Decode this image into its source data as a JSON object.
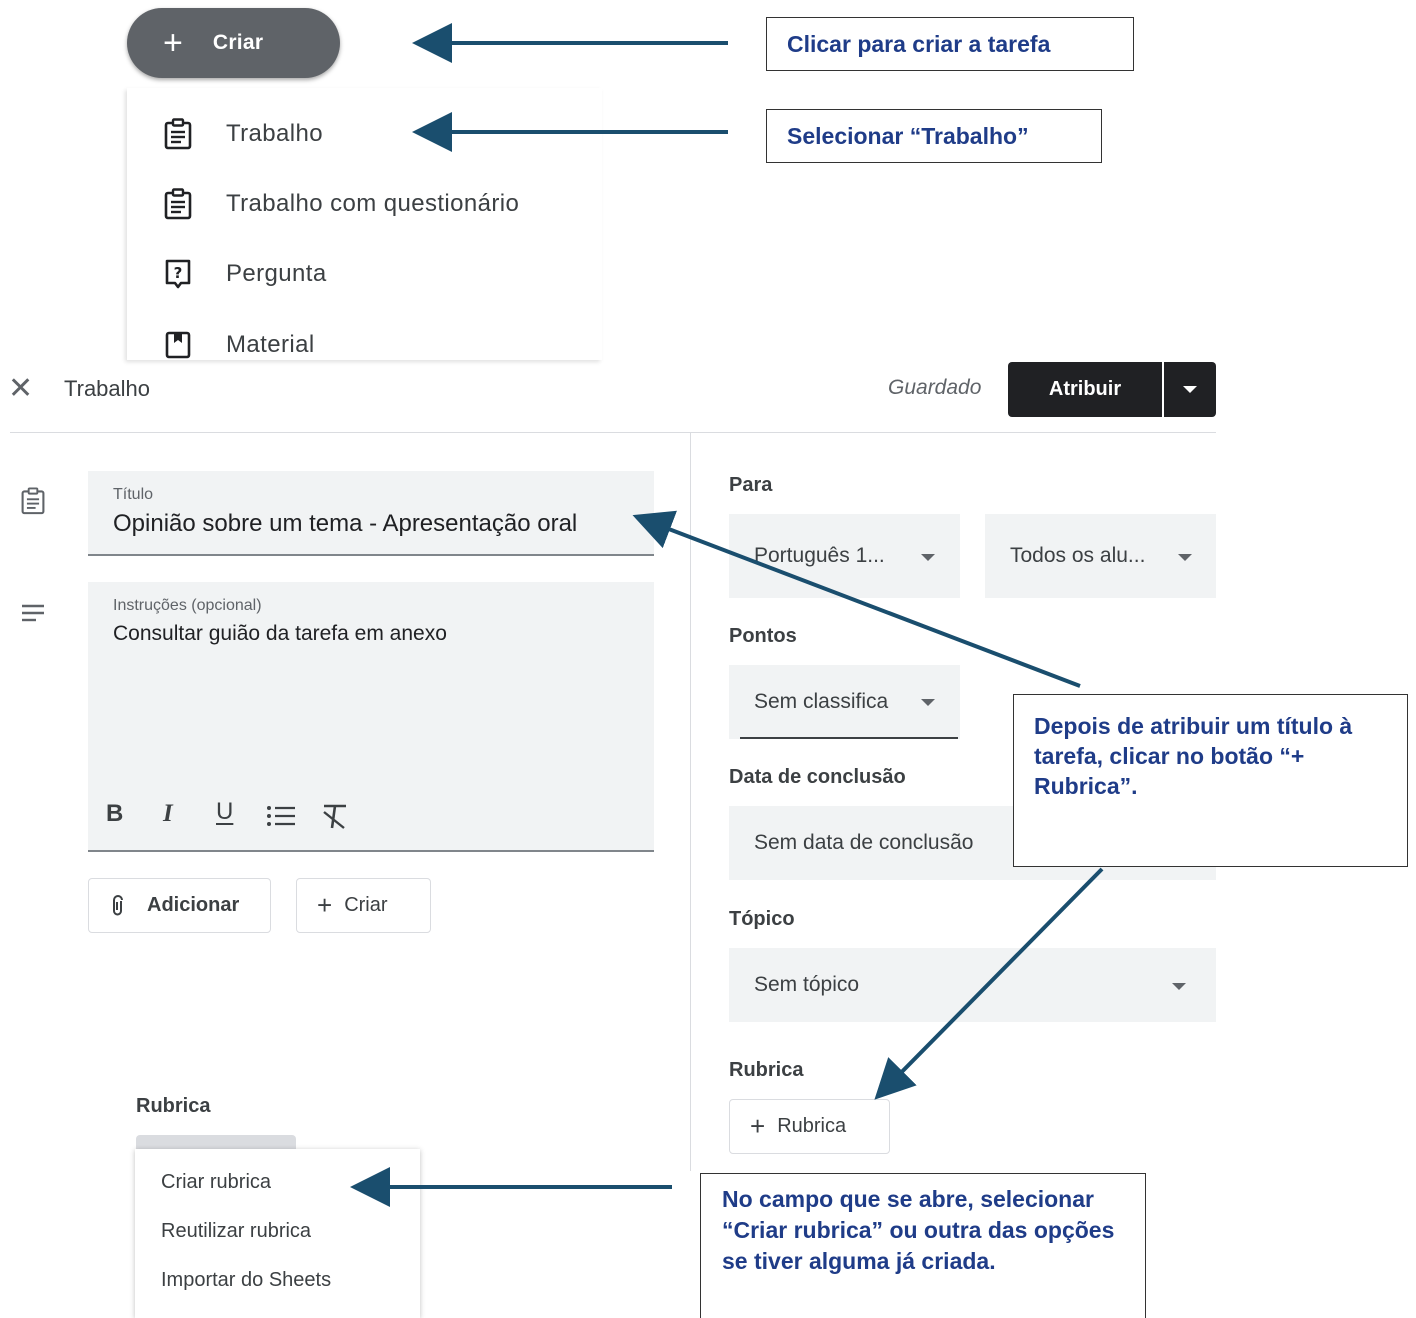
{
  "create_button": {
    "icon": "plus-icon",
    "label": "Criar"
  },
  "create_menu": {
    "items": [
      {
        "label": "Trabalho",
        "icon": "assignment-icon"
      },
      {
        "label": "Trabalho com questionário",
        "icon": "assignment-quiz-icon"
      },
      {
        "label": "Pergunta",
        "icon": "question-icon"
      },
      {
        "label": "Material",
        "icon": "material-icon"
      }
    ]
  },
  "callouts": {
    "create_task": "Clicar para criar a tarefa",
    "select_work": "Selecionar “Trabalho”",
    "after_title": "Depois de atribuir um título à tarefa, clicar no botão “+ Rubrica”.",
    "open_field": "No campo que se abre, selecionar “Criar rubrica” ou outra das opções se tiver alguma já criada."
  },
  "header": {
    "title": "Trabalho",
    "status": "Guardado",
    "assign_label": "Atribuir"
  },
  "form": {
    "title_label": "Título",
    "title_value": "Opinião sobre um tema - Apresentação oral",
    "instructions_label": "Instruções (opcional)",
    "instructions_value": "Consultar guião da tarefa em anexo",
    "format": {
      "bold": "B",
      "italic": "I",
      "underline": "U"
    },
    "add_label": "Adicionar",
    "create_label": "Criar"
  },
  "sidebar": {
    "for_label": "Para",
    "class_value": "Português 1...",
    "students_value": "Todos os alu...",
    "points_label": "Pontos",
    "points_value": "Sem classifica",
    "due_label": "Data de conclusão",
    "due_value": "Sem data de conclusão",
    "topic_label": "Tópico",
    "topic_value": "Sem tópico",
    "rubric_label": "Rubrica",
    "rubric_button": "Rubrica"
  },
  "rubric_menu": {
    "label": "Rubrica",
    "items": [
      "Criar rubrica",
      "Reutilizar rubrica",
      "Importar do Sheets"
    ]
  },
  "colors": {
    "arrow": "#1a4e6e",
    "callout_text": "#1f3c88",
    "assign_bg": "#202124",
    "fab_bg": "#5f6368"
  }
}
